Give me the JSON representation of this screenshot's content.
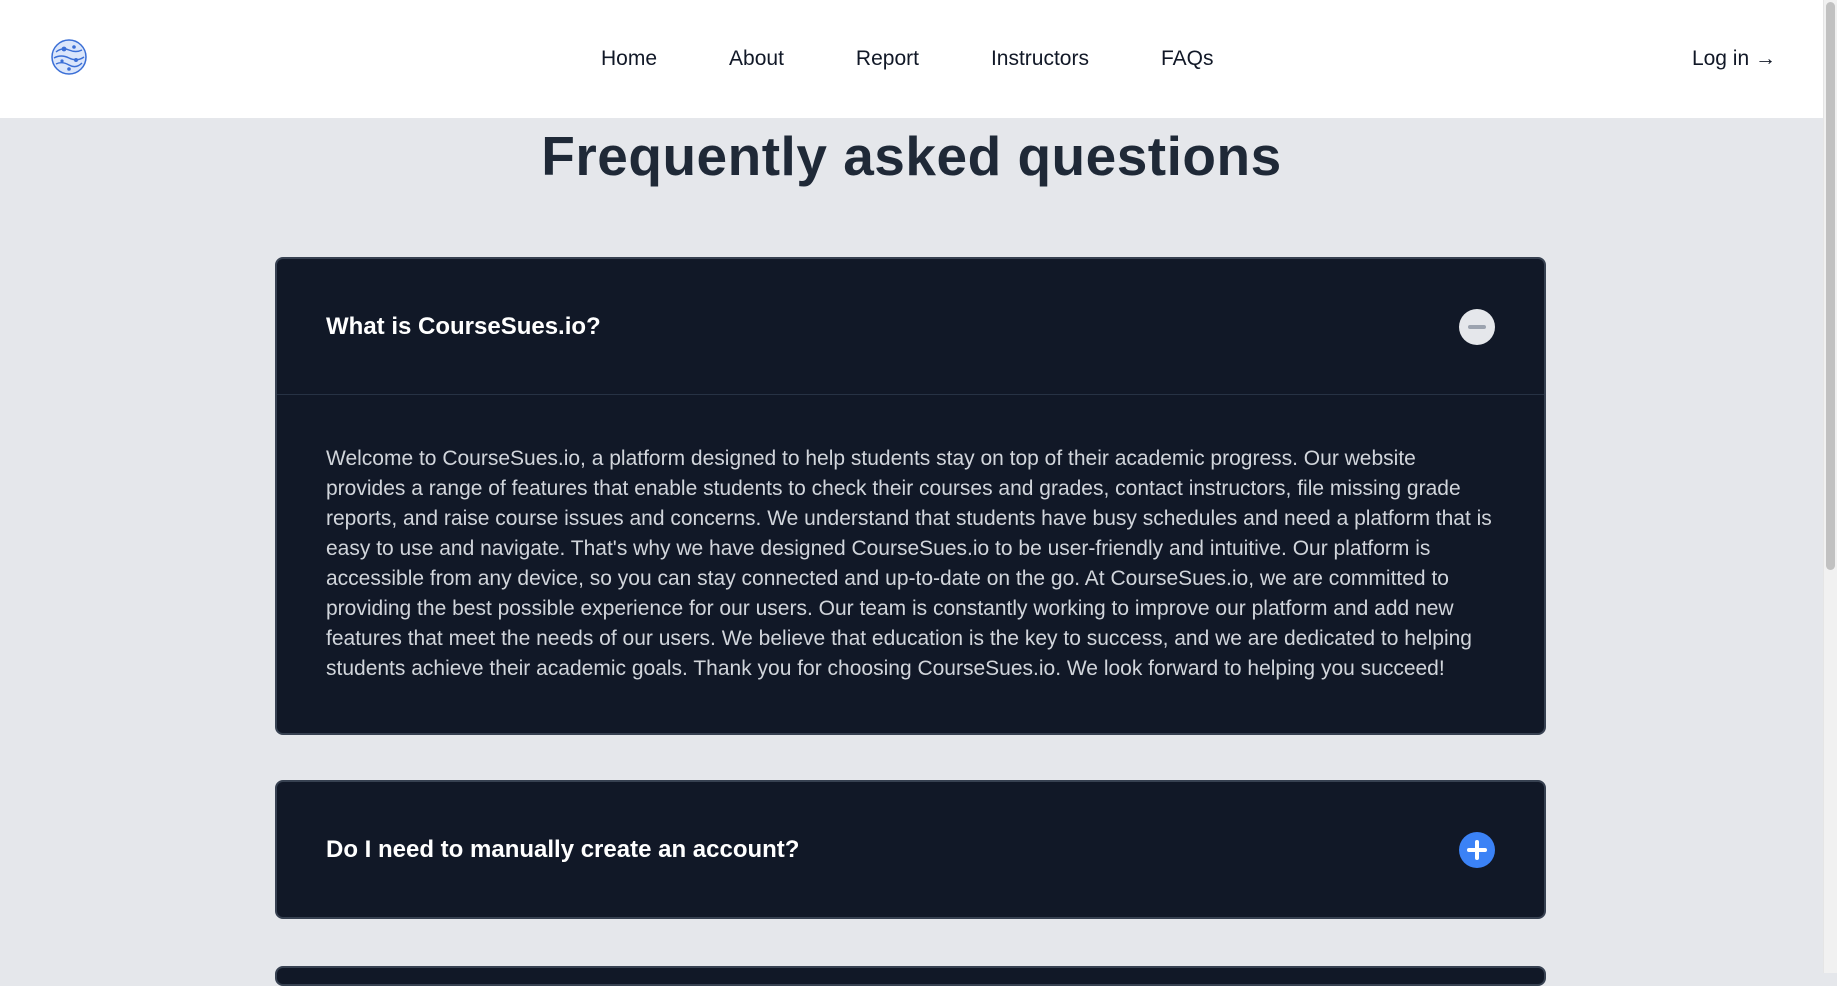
{
  "nav": {
    "links": [
      "Home",
      "About",
      "Report",
      "Instructors",
      "FAQs"
    ],
    "login_label": "Log in →"
  },
  "page": {
    "title": "Frequently asked questions"
  },
  "faqs": [
    {
      "question": "What is CourseSues.io?",
      "expanded": true,
      "answer": "Welcome to CourseSues.io, a platform designed to help students stay on top of their academic progress. Our website provides a range of features that enable students to check their courses and grades, contact instructors, file missing grade reports, and raise course issues and concerns. We understand that students have busy schedules and need a platform that is easy to use and navigate. That's why we have designed CourseSues.io to be user-friendly and intuitive. Our platform is accessible from any device, so you can stay connected and up-to-date on the go. At CourseSues.io, we are committed to providing the best possible experience for our users. Our team is constantly working to improve our platform and add new features that meet the needs of our users. We believe that education is the key to success, and we are dedicated to helping students achieve their academic goals. Thank you for choosing CourseSues.io. We look forward to helping you succeed!"
    },
    {
      "question": "Do I need to manually create an account?",
      "expanded": false
    }
  ],
  "icons": {
    "logo": "globe-logo-icon",
    "collapse": "minus-circle-icon",
    "expand": "plus-circle-icon"
  },
  "colors": {
    "background": "#e5e7eb",
    "card_background": "#111827",
    "accent_blue": "#3b82f6",
    "title_text": "#1f2937"
  }
}
